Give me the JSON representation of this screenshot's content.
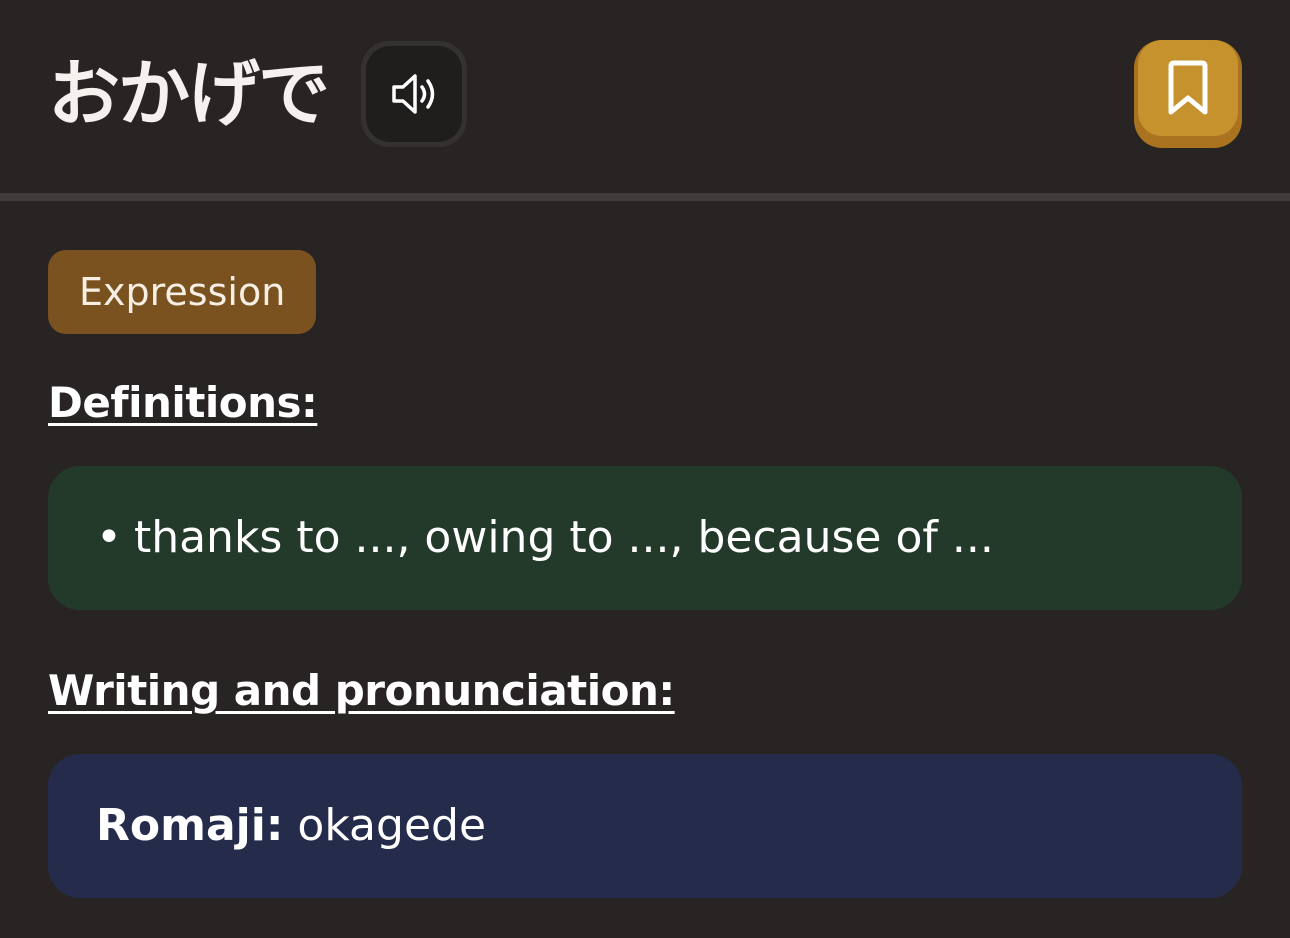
{
  "header": {
    "word": "おかげで",
    "audio_icon": "speaker-icon",
    "bookmark_icon": "bookmark-icon"
  },
  "tag": {
    "label": "Expression"
  },
  "definitions": {
    "title": "Definitions:",
    "items": [
      {
        "bullet": "•",
        "text": "thanks to ..., owing to ..., because of ..."
      }
    ]
  },
  "writing": {
    "title": "Writing and pronunciation:",
    "romaji_label": "Romaji:",
    "romaji_value": "okagede"
  },
  "colors": {
    "background": "#282424",
    "accent": "#c6922e",
    "tag": "#7a521f",
    "definitions_card": "#233a2b",
    "writing_card": "#252b4a"
  }
}
